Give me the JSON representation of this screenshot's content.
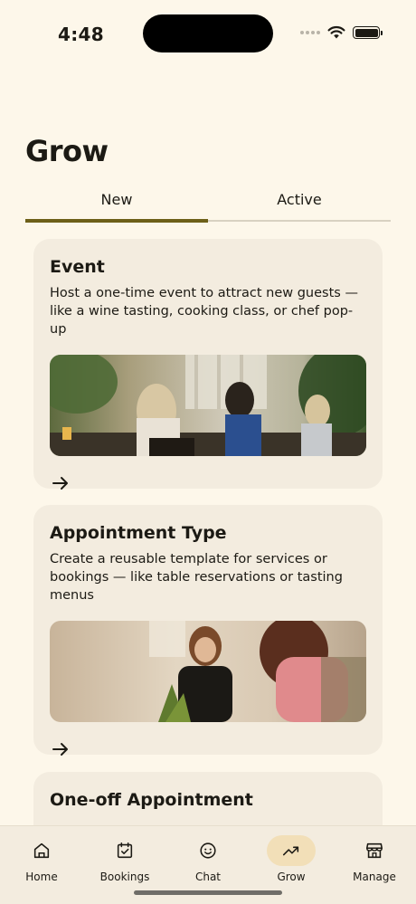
{
  "status_bar": {
    "time": "4:48"
  },
  "page": {
    "title": "Grow"
  },
  "tabs": [
    {
      "label": "New",
      "selected": true
    },
    {
      "label": "Active",
      "selected": false
    }
  ],
  "cards": [
    {
      "title": "Event",
      "description": "Host a one-time event to attract new guests — like a wine tasting, cooking class, or chef pop-up",
      "image": "restaurant-patio-photo"
    },
    {
      "title": "Appointment Type",
      "description": "Create a reusable template for services or bookings — like table reservations or tasting menus",
      "image": "host-greeting-photo"
    },
    {
      "title": "One-off Appointment"
    }
  ],
  "nav": [
    {
      "label": "Home",
      "icon": "home-icon"
    },
    {
      "label": "Bookings",
      "icon": "bookings-icon"
    },
    {
      "label": "Chat",
      "icon": "chat-icon"
    },
    {
      "label": "Grow",
      "icon": "trending-up-icon",
      "selected": true
    },
    {
      "label": "Manage",
      "icon": "storefront-icon"
    }
  ],
  "colors": {
    "background": "#fdf7ea",
    "card": "#f3ecdf",
    "accent": "#6d5f18",
    "nav_selected": "#f2dfb8"
  }
}
